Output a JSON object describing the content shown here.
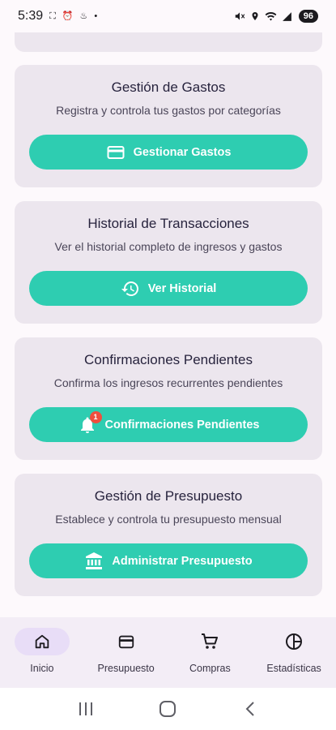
{
  "status_bar": {
    "time": "5:39",
    "battery": "96"
  },
  "cards": [
    {
      "title": "Gestión de Gastos",
      "description": "Registra y controla tus gastos por categorías",
      "button": "Gestionar Gastos",
      "icon": "credit-card-icon"
    },
    {
      "title": "Historial de Transacciones",
      "description": "Ver el historial completo de ingresos y gastos",
      "button": "Ver Historial",
      "icon": "history-icon"
    },
    {
      "title": "Confirmaciones Pendientes",
      "description": "Confirma los ingresos recurrentes pendientes",
      "button": "Confirmaciones Pendientes",
      "icon": "bell-icon",
      "badge": "1"
    },
    {
      "title": "Gestión de Presupuesto",
      "description": "Establece y controla tu presupuesto mensual",
      "button": "Administrar Presupuesto",
      "icon": "bank-icon"
    }
  ],
  "bottom_nav": [
    {
      "label": "Inicio",
      "icon": "home-icon",
      "active": true
    },
    {
      "label": "Presupuesto",
      "icon": "wallet-icon",
      "active": false
    },
    {
      "label": "Compras",
      "icon": "cart-icon",
      "active": false
    },
    {
      "label": "Estadísticas",
      "icon": "pie-chart-icon",
      "active": false
    }
  ],
  "colors": {
    "accent": "#2ecdb1",
    "card_bg": "#ece6ee",
    "badge": "#f04e3e",
    "nav_active": "#e8ddf7"
  }
}
